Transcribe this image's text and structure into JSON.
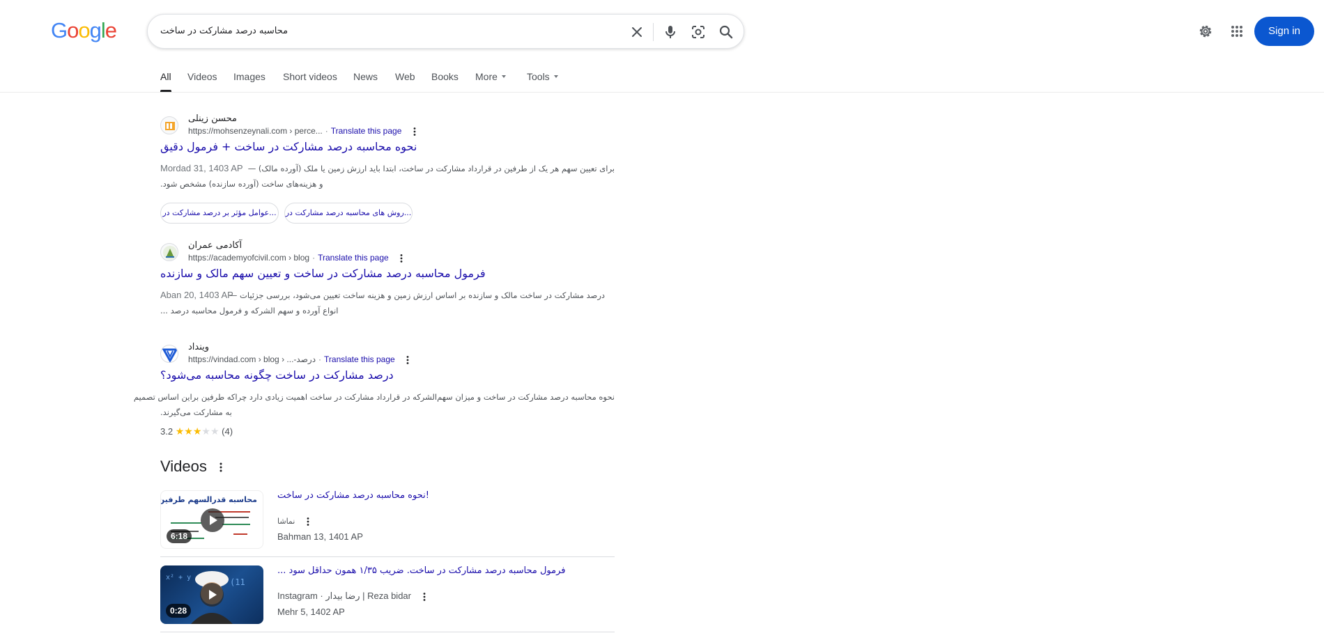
{
  "logo": "Google",
  "search": {
    "query": "محاسبه درصد مشارکت در ساخت"
  },
  "header": {
    "signin_label": "Sign in"
  },
  "tabs": [
    {
      "label": "All",
      "active": true
    },
    {
      "label": "Videos"
    },
    {
      "label": "Images"
    },
    {
      "label": "Short videos"
    },
    {
      "label": "News"
    },
    {
      "label": "Web"
    },
    {
      "label": "Books"
    },
    {
      "label": "More"
    },
    {
      "label": "Tools"
    }
  ],
  "results": [
    {
      "site_name": "محسن زینلی",
      "url": "https://mohsenzeynali.com › perce...",
      "translate": "Translate this page",
      "title": "نحوه محاسبه درصد مشارکت در ساخت + فرمول دقیق",
      "date": "Mordad 31, 1403 AP",
      "snippet_1": "برای تعیین سهم هر یک از طرفین در قرارداد مشارکت در ساخت، ابتدا باید ارزش زمین یا ملک (آورده مالک) —",
      "snippet_2": "و هزینه‌های ساخت (آورده سازنده) مشخص شود.",
      "chips": [
        "روش های محاسبه درصد مشارکت در...",
        "عوامل مؤثر بر درصد مشارکت در..."
      ]
    },
    {
      "site_name": "آکادمی عمران",
      "url": "https://academyofcivil.com › blog",
      "translate": "Translate this page",
      "title": "فرمول محاسبه درصد مشارکت در ساخت و تعیین سهم مالک و سازنده",
      "date": "Aban 20, 1403 AP",
      "snippet_1": "درصد مشارکت در ساخت مالک و سازنده بر اساس ارزش زمین و هزینه ساخت تعیین می‌شود، بررسی جزئیات —",
      "snippet_2": "انواع آورده و سهم الشرکه و فرمول محاسبه درصد ..."
    },
    {
      "site_name": "وینداد",
      "url": "https://vindad.com › blog › ...-درصد",
      "translate": "Translate this page",
      "title": "درصد مشارکت در ساخت چگونه محاسبه می‌شود؟",
      "snippet_1": "نحوه محاسبه درصد مشارکت در ساخت و میزان سهم‌الشرکه در قرارداد مشارکت در ساخت اهمیت زیادی دارد چراکه طرفین براین اساس تصمیم",
      "snippet_2": "به مشارکت می‌گیرند.",
      "rating_value": "3.2",
      "rating_stars": 3.2,
      "rating_count": "(4)"
    }
  ],
  "videos": {
    "heading": "Videos",
    "items": [
      {
        "title": "!نحوه محاسبه درصد مشارکت در ساخت",
        "source": "نماشا",
        "date": "Bahman 13, 1401 AP",
        "duration": "6:18",
        "thumb_text": "محاسبه قدرالسهم طرفین"
      },
      {
        "title": "فرمول محاسبه درصد مشارکت در ساخت. ضریب ۱/۳۵ همون حداقل سود ...",
        "source": "Instagram · رضا بیدار | Reza bidar",
        "date": "Mehr 5, 1402 AP",
        "duration": "0:28"
      }
    ]
  },
  "colors": {
    "link": "#1a0dab",
    "signin_bg": "#0b57d0",
    "star": "#fbbc04"
  }
}
